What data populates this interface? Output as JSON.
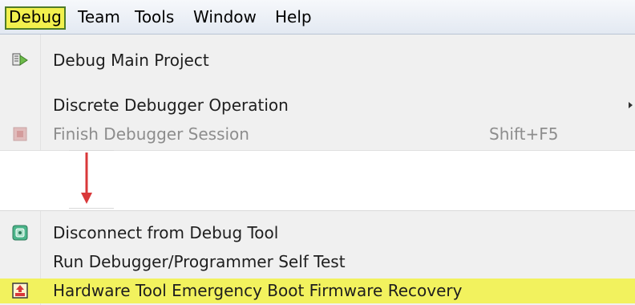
{
  "menubar": {
    "items": [
      "Debug",
      "Team",
      "Tools",
      "Window",
      "Help"
    ],
    "active_index": 0
  },
  "menu_top": [
    {
      "label": "Debug Main Project",
      "shortcut": "",
      "icon": "debug-main-project-icon",
      "enabled": true,
      "submenu": false
    },
    {
      "label": "Discrete Debugger Operation",
      "shortcut": "",
      "icon": "",
      "enabled": true,
      "submenu": true
    },
    {
      "label": "Finish Debugger Session",
      "shortcut": "Shift+F5",
      "icon": "finish-session-icon",
      "enabled": false,
      "submenu": false
    }
  ],
  "menu_bottom": [
    {
      "label": "Disconnect from Debug Tool",
      "shortcut": "",
      "icon": "disconnect-icon",
      "enabled": true,
      "highlighted": false
    },
    {
      "label": "Run Debugger/Programmer Self Test",
      "shortcut": "",
      "icon": "",
      "enabled": true,
      "highlighted": false
    },
    {
      "label": "Hardware Tool Emergency Boot Firmware Recovery",
      "shortcut": "",
      "icon": "firmware-recovery-icon",
      "enabled": true,
      "highlighted": true
    }
  ],
  "colors": {
    "highlight": "#f2f25e",
    "active_menubar": "#f2f04d",
    "arrow": "#d9383a",
    "menu_bg": "#f0f0f0",
    "disabled_text": "#8d8d8d"
  }
}
